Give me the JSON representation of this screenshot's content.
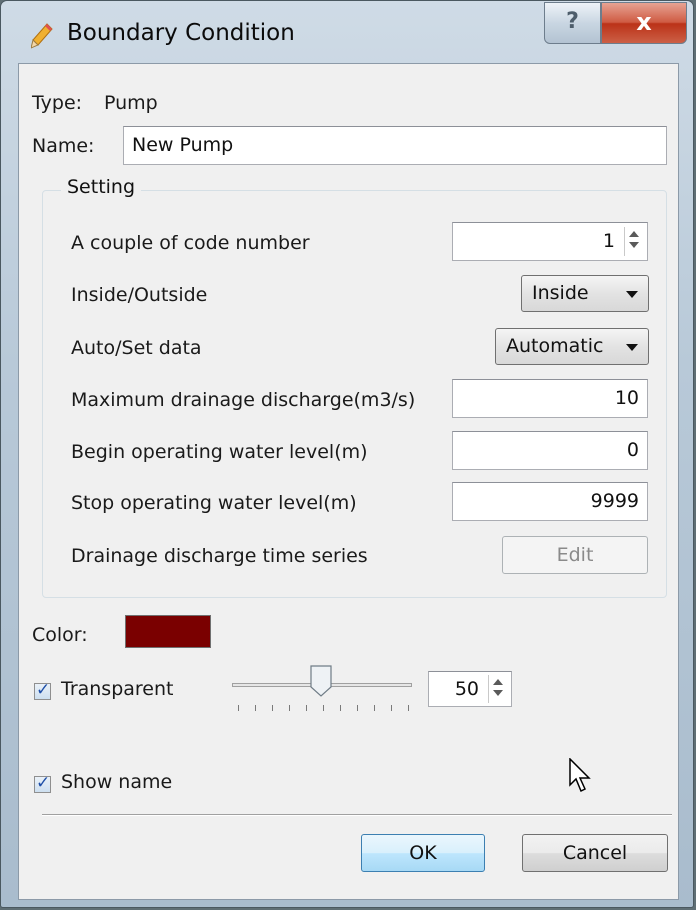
{
  "window": {
    "title": "Boundary Condition",
    "help_label": "?",
    "close_label": "x"
  },
  "type": {
    "label": "Type:",
    "value": "Pump"
  },
  "name": {
    "label": "Name:",
    "value": "New Pump"
  },
  "setting": {
    "title": "Setting",
    "code_number": {
      "label": "A couple of code number",
      "value": "1"
    },
    "inside_outside": {
      "label": "Inside/Outside",
      "value": "Inside"
    },
    "auto_set": {
      "label": "Auto/Set data",
      "value": "Automatic"
    },
    "max_discharge": {
      "label": "Maximum drainage discharge(m3/s)",
      "value": "10"
    },
    "begin_level": {
      "label": "Begin operating water level(m)",
      "value": "0"
    },
    "stop_level": {
      "label": "Stop operating water level(m)",
      "value": "9999"
    },
    "time_series": {
      "label": "Drainage discharge time series",
      "button": "Edit"
    }
  },
  "color": {
    "label": "Color:",
    "value": "#7a0000"
  },
  "transparent": {
    "label": "Transparent",
    "checked": true,
    "value": "50",
    "slider_fraction": 0.5
  },
  "show_name": {
    "label": "Show name",
    "checked": true
  },
  "buttons": {
    "ok": "OK",
    "cancel": "Cancel"
  },
  "colors": {
    "accent": "#3c7fb1",
    "close": "#c4442a"
  }
}
